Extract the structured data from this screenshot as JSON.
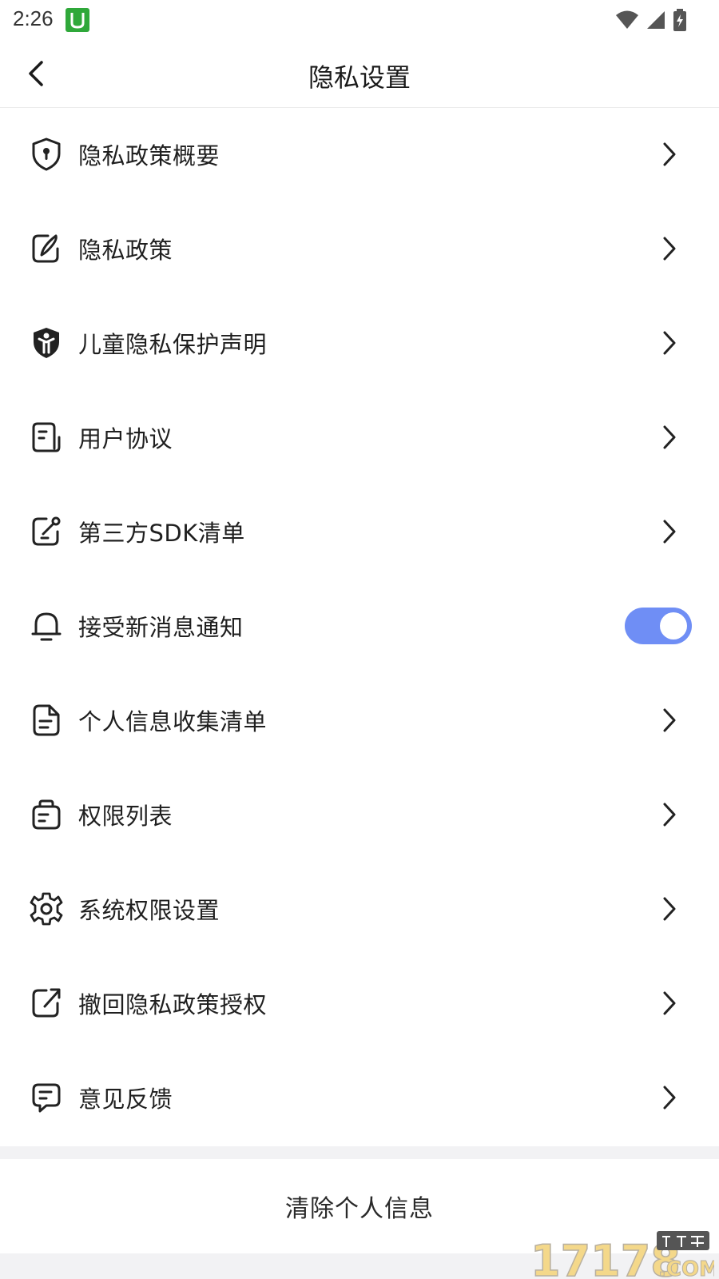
{
  "status_bar": {
    "time": "2:26",
    "badge_letter": "U",
    "icons": [
      "wifi-icon",
      "cell-signal-icon",
      "battery-charging-icon"
    ]
  },
  "nav": {
    "title": "隐私设置",
    "back_icon": "chevron-left-icon"
  },
  "menu": [
    {
      "id": "privacy-summary",
      "label": "隐私政策概要",
      "icon": "shield-lock-icon",
      "control": "chevron"
    },
    {
      "id": "privacy-policy",
      "label": "隐私政策",
      "icon": "edit-note-icon",
      "control": "chevron"
    },
    {
      "id": "child-privacy",
      "label": "儿童隐私保护声明",
      "icon": "child-shield-icon",
      "control": "chevron"
    },
    {
      "id": "user-agreement",
      "label": "用户协议",
      "icon": "document-icon",
      "control": "chevron"
    },
    {
      "id": "third-party-sdk",
      "label": "第三方SDK清单",
      "icon": "external-edit-icon",
      "control": "chevron"
    },
    {
      "id": "new-message-notify",
      "label": "接受新消息通知",
      "icon": "bell-icon",
      "control": "toggle",
      "toggle_on": true
    },
    {
      "id": "personal-info-list",
      "label": "个人信息收集清单",
      "icon": "file-text-icon",
      "control": "chevron"
    },
    {
      "id": "permission-list",
      "label": "权限列表",
      "icon": "briefcase-list-icon",
      "control": "chevron"
    },
    {
      "id": "system-permission",
      "label": "系统权限设置",
      "icon": "gear-icon",
      "control": "chevron"
    },
    {
      "id": "revoke-authorization",
      "label": "撤回隐私政策授权",
      "icon": "share-out-icon",
      "control": "chevron"
    },
    {
      "id": "feedback",
      "label": "意见反馈",
      "icon": "message-icon",
      "control": "chevron"
    }
  ],
  "clear_button": {
    "label": "清除个人信息"
  },
  "colors": {
    "toggle_on": "#6f8ef5",
    "badge_green": "#2fa83a",
    "band_gray": "#f2f2f4"
  }
}
